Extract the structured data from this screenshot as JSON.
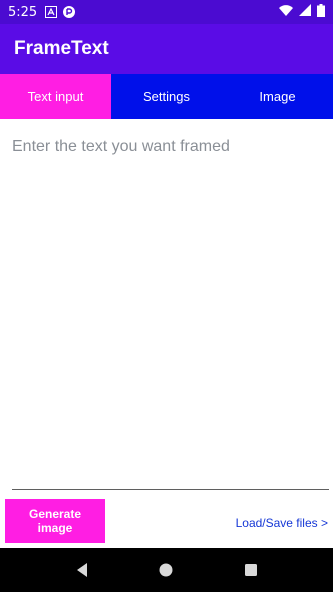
{
  "status_bar": {
    "time": "5:25",
    "left_icons": [
      "a-badge-icon",
      "app-logo-icon"
    ],
    "right_icons": [
      "wifi-icon",
      "signal-icon",
      "battery-icon"
    ]
  },
  "app_bar": {
    "title": "FrameText"
  },
  "tabs": [
    {
      "label": "Text input",
      "active": true
    },
    {
      "label": "Settings",
      "active": false
    },
    {
      "label": "Image",
      "active": false
    }
  ],
  "editor": {
    "placeholder": "Enter the text you want framed",
    "value": ""
  },
  "actions": {
    "generate_label": "Generate image",
    "load_save_label": "Load/Save files >"
  },
  "nav_bar": {
    "icons": [
      "back-icon",
      "home-icon",
      "recents-icon"
    ]
  },
  "colors": {
    "status_bar": "#4b0bd1",
    "app_bar": "#5a0ce6",
    "tab_bg": "#0010ea",
    "tab_active": "#ff1ee3",
    "link": "#1537d6"
  }
}
